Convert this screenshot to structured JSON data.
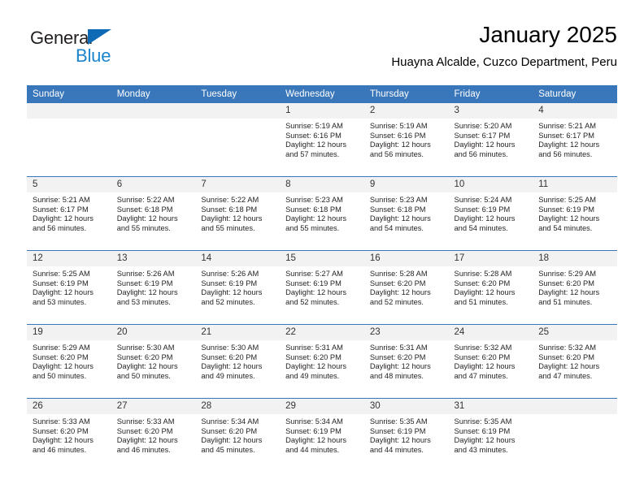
{
  "brand": {
    "name_part1": "General",
    "name_part2": "Blue",
    "triangle_color": "#0e6ab5",
    "blue_color": "#1b84cd"
  },
  "header": {
    "title": "January 2025",
    "subtitle": "Huayna Alcalde, Cuzco Department, Peru",
    "accent_color": "#3a77ba",
    "daynum_band_color": "#f2f2f2"
  },
  "weekday_headers": [
    "Sunday",
    "Monday",
    "Tuesday",
    "Wednesday",
    "Thursday",
    "Friday",
    "Saturday"
  ],
  "labels": {
    "sunrise": "Sunrise:",
    "sunset": "Sunset:",
    "daylight": "Daylight:"
  },
  "weeks": [
    [
      {
        "day": "",
        "sunrise": "",
        "sunset": "",
        "daylight_line1": "",
        "daylight_line2": ""
      },
      {
        "day": "",
        "sunrise": "",
        "sunset": "",
        "daylight_line1": "",
        "daylight_line2": ""
      },
      {
        "day": "",
        "sunrise": "",
        "sunset": "",
        "daylight_line1": "",
        "daylight_line2": ""
      },
      {
        "day": "1",
        "sunrise": "Sunrise: 5:19 AM",
        "sunset": "Sunset: 6:16 PM",
        "daylight_line1": "Daylight: 12 hours",
        "daylight_line2": "and 57 minutes."
      },
      {
        "day": "2",
        "sunrise": "Sunrise: 5:19 AM",
        "sunset": "Sunset: 6:16 PM",
        "daylight_line1": "Daylight: 12 hours",
        "daylight_line2": "and 56 minutes."
      },
      {
        "day": "3",
        "sunrise": "Sunrise: 5:20 AM",
        "sunset": "Sunset: 6:17 PM",
        "daylight_line1": "Daylight: 12 hours",
        "daylight_line2": "and 56 minutes."
      },
      {
        "day": "4",
        "sunrise": "Sunrise: 5:21 AM",
        "sunset": "Sunset: 6:17 PM",
        "daylight_line1": "Daylight: 12 hours",
        "daylight_line2": "and 56 minutes."
      }
    ],
    [
      {
        "day": "5",
        "sunrise": "Sunrise: 5:21 AM",
        "sunset": "Sunset: 6:17 PM",
        "daylight_line1": "Daylight: 12 hours",
        "daylight_line2": "and 56 minutes."
      },
      {
        "day": "6",
        "sunrise": "Sunrise: 5:22 AM",
        "sunset": "Sunset: 6:18 PM",
        "daylight_line1": "Daylight: 12 hours",
        "daylight_line2": "and 55 minutes."
      },
      {
        "day": "7",
        "sunrise": "Sunrise: 5:22 AM",
        "sunset": "Sunset: 6:18 PM",
        "daylight_line1": "Daylight: 12 hours",
        "daylight_line2": "and 55 minutes."
      },
      {
        "day": "8",
        "sunrise": "Sunrise: 5:23 AM",
        "sunset": "Sunset: 6:18 PM",
        "daylight_line1": "Daylight: 12 hours",
        "daylight_line2": "and 55 minutes."
      },
      {
        "day": "9",
        "sunrise": "Sunrise: 5:23 AM",
        "sunset": "Sunset: 6:18 PM",
        "daylight_line1": "Daylight: 12 hours",
        "daylight_line2": "and 54 minutes."
      },
      {
        "day": "10",
        "sunrise": "Sunrise: 5:24 AM",
        "sunset": "Sunset: 6:19 PM",
        "daylight_line1": "Daylight: 12 hours",
        "daylight_line2": "and 54 minutes."
      },
      {
        "day": "11",
        "sunrise": "Sunrise: 5:25 AM",
        "sunset": "Sunset: 6:19 PM",
        "daylight_line1": "Daylight: 12 hours",
        "daylight_line2": "and 54 minutes."
      }
    ],
    [
      {
        "day": "12",
        "sunrise": "Sunrise: 5:25 AM",
        "sunset": "Sunset: 6:19 PM",
        "daylight_line1": "Daylight: 12 hours",
        "daylight_line2": "and 53 minutes."
      },
      {
        "day": "13",
        "sunrise": "Sunrise: 5:26 AM",
        "sunset": "Sunset: 6:19 PM",
        "daylight_line1": "Daylight: 12 hours",
        "daylight_line2": "and 53 minutes."
      },
      {
        "day": "14",
        "sunrise": "Sunrise: 5:26 AM",
        "sunset": "Sunset: 6:19 PM",
        "daylight_line1": "Daylight: 12 hours",
        "daylight_line2": "and 52 minutes."
      },
      {
        "day": "15",
        "sunrise": "Sunrise: 5:27 AM",
        "sunset": "Sunset: 6:19 PM",
        "daylight_line1": "Daylight: 12 hours",
        "daylight_line2": "and 52 minutes."
      },
      {
        "day": "16",
        "sunrise": "Sunrise: 5:28 AM",
        "sunset": "Sunset: 6:20 PM",
        "daylight_line1": "Daylight: 12 hours",
        "daylight_line2": "and 52 minutes."
      },
      {
        "day": "17",
        "sunrise": "Sunrise: 5:28 AM",
        "sunset": "Sunset: 6:20 PM",
        "daylight_line1": "Daylight: 12 hours",
        "daylight_line2": "and 51 minutes."
      },
      {
        "day": "18",
        "sunrise": "Sunrise: 5:29 AM",
        "sunset": "Sunset: 6:20 PM",
        "daylight_line1": "Daylight: 12 hours",
        "daylight_line2": "and 51 minutes."
      }
    ],
    [
      {
        "day": "19",
        "sunrise": "Sunrise: 5:29 AM",
        "sunset": "Sunset: 6:20 PM",
        "daylight_line1": "Daylight: 12 hours",
        "daylight_line2": "and 50 minutes."
      },
      {
        "day": "20",
        "sunrise": "Sunrise: 5:30 AM",
        "sunset": "Sunset: 6:20 PM",
        "daylight_line1": "Daylight: 12 hours",
        "daylight_line2": "and 50 minutes."
      },
      {
        "day": "21",
        "sunrise": "Sunrise: 5:30 AM",
        "sunset": "Sunset: 6:20 PM",
        "daylight_line1": "Daylight: 12 hours",
        "daylight_line2": "and 49 minutes."
      },
      {
        "day": "22",
        "sunrise": "Sunrise: 5:31 AM",
        "sunset": "Sunset: 6:20 PM",
        "daylight_line1": "Daylight: 12 hours",
        "daylight_line2": "and 49 minutes."
      },
      {
        "day": "23",
        "sunrise": "Sunrise: 5:31 AM",
        "sunset": "Sunset: 6:20 PM",
        "daylight_line1": "Daylight: 12 hours",
        "daylight_line2": "and 48 minutes."
      },
      {
        "day": "24",
        "sunrise": "Sunrise: 5:32 AM",
        "sunset": "Sunset: 6:20 PM",
        "daylight_line1": "Daylight: 12 hours",
        "daylight_line2": "and 47 minutes."
      },
      {
        "day": "25",
        "sunrise": "Sunrise: 5:32 AM",
        "sunset": "Sunset: 6:20 PM",
        "daylight_line1": "Daylight: 12 hours",
        "daylight_line2": "and 47 minutes."
      }
    ],
    [
      {
        "day": "26",
        "sunrise": "Sunrise: 5:33 AM",
        "sunset": "Sunset: 6:20 PM",
        "daylight_line1": "Daylight: 12 hours",
        "daylight_line2": "and 46 minutes."
      },
      {
        "day": "27",
        "sunrise": "Sunrise: 5:33 AM",
        "sunset": "Sunset: 6:20 PM",
        "daylight_line1": "Daylight: 12 hours",
        "daylight_line2": "and 46 minutes."
      },
      {
        "day": "28",
        "sunrise": "Sunrise: 5:34 AM",
        "sunset": "Sunset: 6:20 PM",
        "daylight_line1": "Daylight: 12 hours",
        "daylight_line2": "and 45 minutes."
      },
      {
        "day": "29",
        "sunrise": "Sunrise: 5:34 AM",
        "sunset": "Sunset: 6:19 PM",
        "daylight_line1": "Daylight: 12 hours",
        "daylight_line2": "and 44 minutes."
      },
      {
        "day": "30",
        "sunrise": "Sunrise: 5:35 AM",
        "sunset": "Sunset: 6:19 PM",
        "daylight_line1": "Daylight: 12 hours",
        "daylight_line2": "and 44 minutes."
      },
      {
        "day": "31",
        "sunrise": "Sunrise: 5:35 AM",
        "sunset": "Sunset: 6:19 PM",
        "daylight_line1": "Daylight: 12 hours",
        "daylight_line2": "and 43 minutes."
      },
      {
        "day": "",
        "sunrise": "",
        "sunset": "",
        "daylight_line1": "",
        "daylight_line2": ""
      }
    ]
  ]
}
